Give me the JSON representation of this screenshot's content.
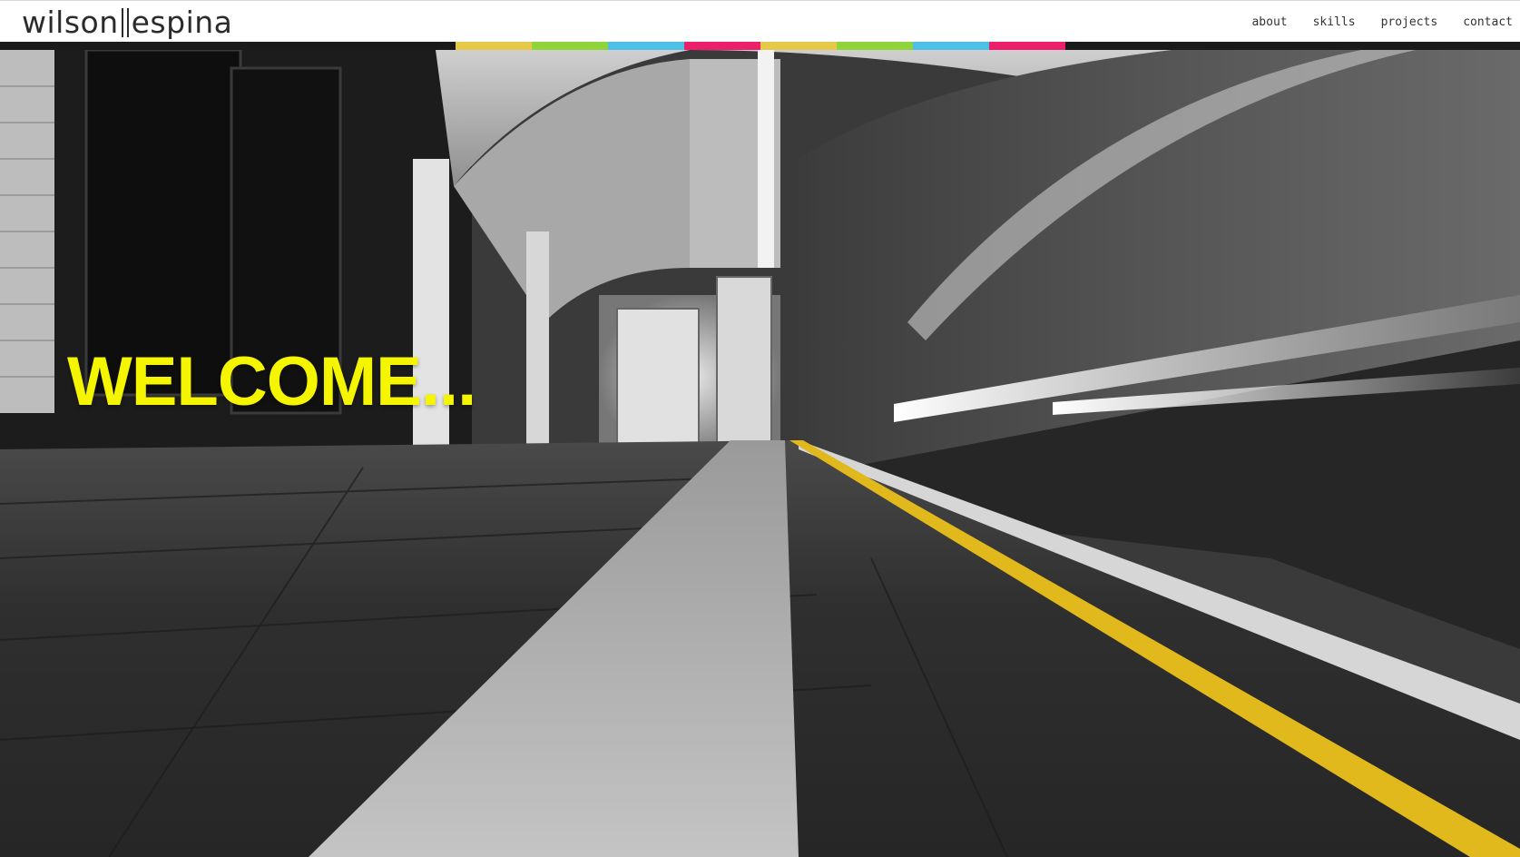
{
  "header": {
    "logo": {
      "left": "wilson",
      "right": "espina"
    },
    "nav": [
      {
        "label": "about"
      },
      {
        "label": "skills"
      },
      {
        "label": "projects"
      },
      {
        "label": "contact"
      }
    ]
  },
  "colorbar": {
    "colors": [
      "#e7c94a",
      "#8fd43a",
      "#4ebfe6",
      "#ec1f6a",
      "#e7c94a",
      "#8fd43a",
      "#4ebfe6",
      "#ec1f6a"
    ]
  },
  "hero": {
    "headline": "WELCOME...",
    "headline_color": "#f5f500",
    "stripe_color": "#e2b91c"
  }
}
